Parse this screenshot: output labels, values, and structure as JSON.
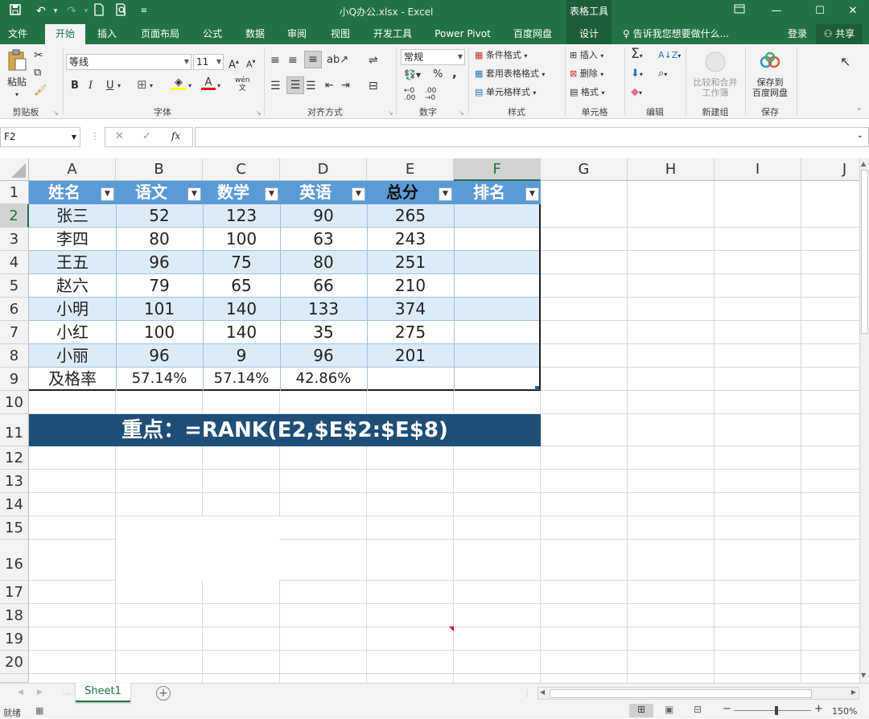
{
  "titlebar": {
    "title": "小Q办公.xlsx - Excel",
    "context_header": "表格工具",
    "save_icon": "save-icon",
    "undo_icon": "undo-icon",
    "redo_icon": "redo-icon",
    "new_icon": "new-file-icon",
    "preview_icon": "print-preview-icon"
  },
  "tabs": [
    {
      "label": "文件"
    },
    {
      "label": "开始"
    },
    {
      "label": "插入"
    },
    {
      "label": "页面布局"
    },
    {
      "label": "公式"
    },
    {
      "label": "数据"
    },
    {
      "label": "审阅"
    },
    {
      "label": "视图"
    },
    {
      "label": "开发工具"
    },
    {
      "label": "Power Pivot"
    },
    {
      "label": "百度网盘"
    },
    {
      "label": "设计"
    }
  ],
  "tell_me": "告诉我您想要做什么...",
  "login": "登录",
  "share": "共享",
  "ribbon": {
    "clipboard": {
      "paste": "粘贴",
      "label": "剪贴板"
    },
    "font": {
      "name": "等线",
      "size": "11",
      "label": "字体",
      "bold": "B",
      "italic": "I",
      "underline": "U",
      "grow": "A",
      "shrink": "A",
      "font_color": "A",
      "phonetic": "wén"
    },
    "align": {
      "label": "对齐方式"
    },
    "number": {
      "format": "常规",
      "label": "数字",
      "percent": "%",
      "comma": ","
    },
    "styles": {
      "cond": "条件格式",
      "table": "套用表格格式",
      "cell": "单元格样式",
      "label": "样式"
    },
    "cells": {
      "insert": "插入",
      "delete": "删除",
      "format": "格式",
      "label": "单元格"
    },
    "editing": {
      "label": "编辑"
    },
    "compare": {
      "line1": "比较和合并",
      "line2": "工作簿",
      "label": "新建组"
    },
    "save": {
      "line1": "保存到",
      "line2": "百度网盘",
      "label": "保存"
    }
  },
  "formula_bar": {
    "name_box": "F2",
    "fx": "fx",
    "value": ""
  },
  "columns": [
    "A",
    "B",
    "C",
    "D",
    "E",
    "F",
    "G",
    "H",
    "I",
    "J"
  ],
  "rows": [
    "1",
    "2",
    "3",
    "4",
    "5",
    "6",
    "7",
    "8",
    "9",
    "10",
    "11",
    "12",
    "13",
    "14",
    "15",
    "16",
    "17",
    "18",
    "19",
    "20"
  ],
  "table": {
    "headers": [
      "姓名",
      "语文",
      "数学",
      "英语",
      "总分",
      "排名"
    ],
    "rows": [
      [
        "张三",
        "52",
        "123",
        "90",
        "265",
        ""
      ],
      [
        "李四",
        "80",
        "100",
        "63",
        "243",
        ""
      ],
      [
        "王五",
        "96",
        "75",
        "80",
        "251",
        ""
      ],
      [
        "赵六",
        "79",
        "65",
        "66",
        "210",
        ""
      ],
      [
        "小明",
        "101",
        "140",
        "133",
        "374",
        ""
      ],
      [
        "小红",
        "100",
        "140",
        "35",
        "275",
        ""
      ],
      [
        "小丽",
        "96",
        "9",
        "96",
        "201",
        ""
      ]
    ],
    "total_row": [
      "及格率",
      "57.14%",
      "57.14%",
      "42.86%",
      "",
      ""
    ]
  },
  "banner": "重点：=RANK(E2,$E$2:$E$8)",
  "colors": {
    "excel_green": "#217346",
    "table_header": "#5b9bd5",
    "band": "#ddebf7",
    "banner": "#1f4e79"
  },
  "sheet_tab": "Sheet1",
  "status": {
    "ready": "就绪",
    "zoom": "150%"
  }
}
